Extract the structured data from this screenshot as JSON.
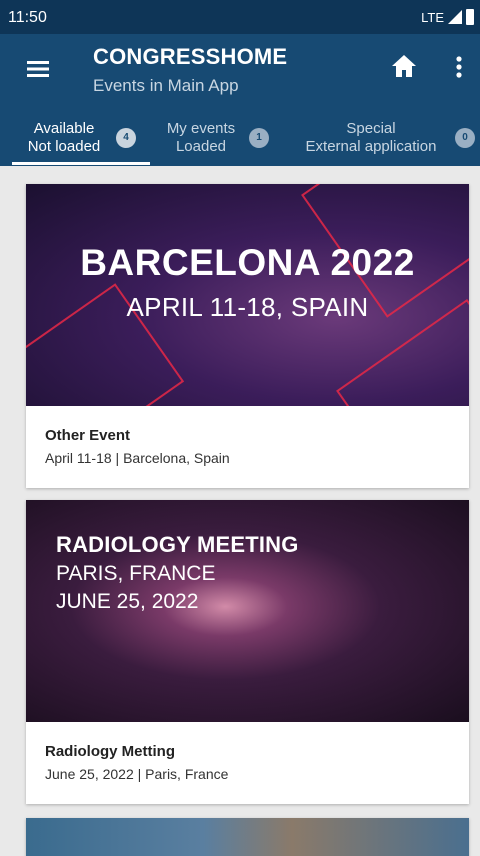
{
  "status_bar": {
    "time": "11:50",
    "network": "LTE"
  },
  "app_bar": {
    "title": "CONGRESSHOME",
    "subtitle": "Events in Main App"
  },
  "tabs": [
    {
      "line1": "Available",
      "line2": "Not loaded",
      "count": "4",
      "active": true
    },
    {
      "line1": "My events",
      "line2": "Loaded",
      "count": "1",
      "active": false
    },
    {
      "line1": "Special",
      "line2": "External application",
      "count": "0",
      "active": false
    }
  ],
  "events": [
    {
      "banner_line1": "BARCELONA 2022",
      "banner_line2": "APRIL 11-18, SPAIN",
      "name": "Other Event",
      "details": "April 11-18 | Barcelona, Spain"
    },
    {
      "banner_line1": "RADIOLOGY MEETING",
      "banner_line2": "PARIS, FRANCE",
      "banner_line3": "JUNE 25, 2022",
      "name": "Radiology Metting",
      "details": "June 25, 2022 | Paris, France"
    }
  ],
  "colors": {
    "status_bar": "#0e3557",
    "app_bar": "#174a73",
    "background": "#e9e9e9"
  }
}
